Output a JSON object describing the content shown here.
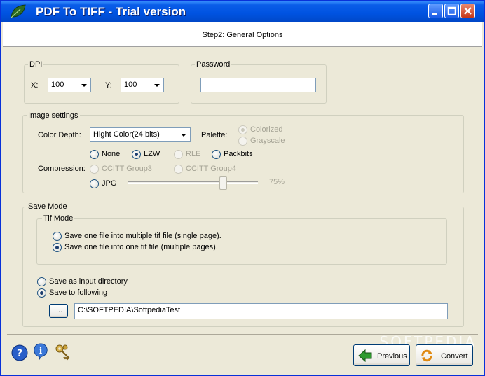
{
  "window": {
    "title": "PDF To TIFF - Trial version"
  },
  "header": {
    "step_title": "Step2: General Options"
  },
  "dpi": {
    "group_label": "DPI",
    "x_label": "X:",
    "x_value": "100",
    "y_label": "Y:",
    "y_value": "100"
  },
  "password": {
    "group_label": "Password",
    "value": ""
  },
  "image_settings": {
    "group_label": "Image settings",
    "color_depth_label": "Color Depth:",
    "color_depth_value": "Hight Color(24 bits)",
    "palette_label": "Palette:",
    "palette_options": [
      {
        "label": "Colorized",
        "checked": true,
        "enabled": false
      },
      {
        "label": "Grayscale",
        "checked": false,
        "enabled": false
      }
    ],
    "compression_label": "Compression:",
    "compression_options": [
      {
        "label": "None",
        "checked": false,
        "enabled": true
      },
      {
        "label": "LZW",
        "checked": true,
        "enabled": true
      },
      {
        "label": "RLE",
        "checked": false,
        "enabled": false
      },
      {
        "label": "Packbits",
        "checked": false,
        "enabled": true
      },
      {
        "label": "CCITT Group3",
        "checked": false,
        "enabled": false
      },
      {
        "label": "CCITT Group4",
        "checked": false,
        "enabled": false
      },
      {
        "label": "JPG",
        "checked": false,
        "enabled": true
      }
    ],
    "jpg_quality": {
      "value": 75,
      "label": "75%"
    }
  },
  "save_mode": {
    "group_label": "Save Mode",
    "tif_mode": {
      "group_label": "Tif Mode",
      "options": [
        {
          "label": "Save one file into multiple tif file (single page).",
          "checked": false
        },
        {
          "label": "Save one file into one tif file (multiple pages).",
          "checked": true
        }
      ]
    },
    "output_options": [
      {
        "label": "Save as input directory",
        "checked": false
      },
      {
        "label": "Save to following",
        "checked": true
      }
    ],
    "browse_label": "...",
    "output_path": "C:\\SOFTPEDIA\\SoftpediaTest"
  },
  "footer": {
    "previous_label": "Previous",
    "convert_label": "Convert",
    "icons": [
      "help-icon",
      "info-icon",
      "key-icon"
    ]
  },
  "watermark": "SOFTPEDIA",
  "colors": {
    "titlebar": "#0053e1",
    "background": "#ece9d8",
    "accent_green": "#21a121"
  }
}
